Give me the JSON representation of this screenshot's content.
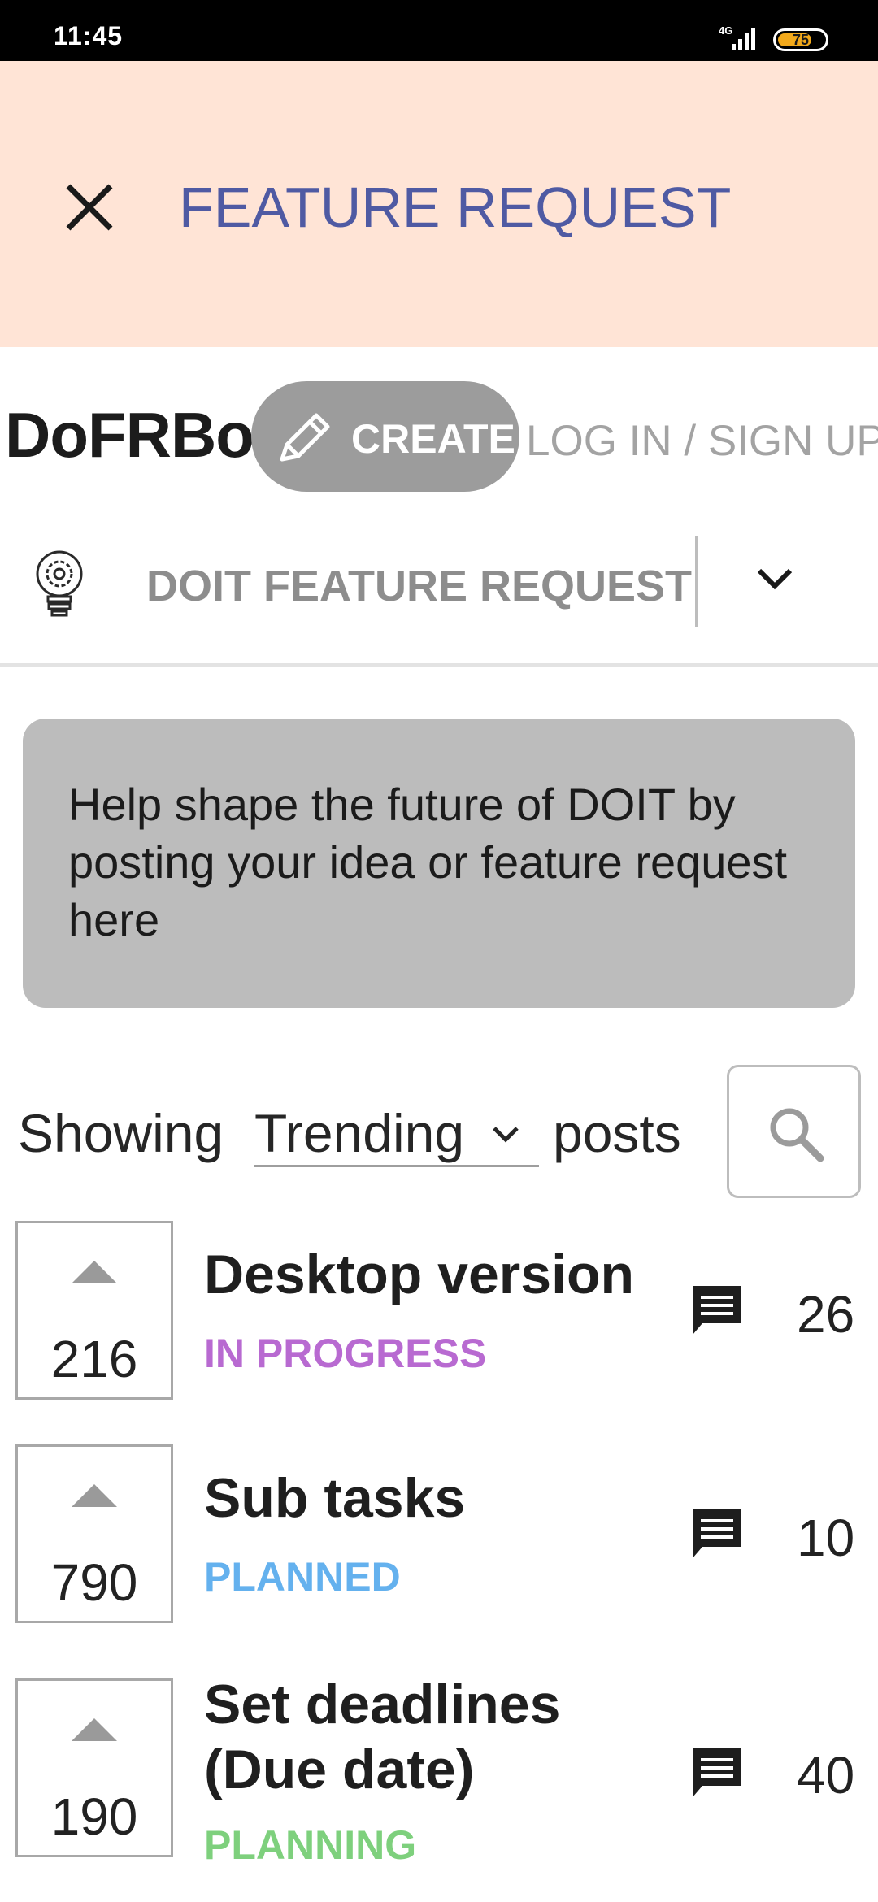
{
  "status_bar": {
    "time": "11:45",
    "network": "4G",
    "battery": "75",
    "battery_level": 0.75
  },
  "header": {
    "title": "FEATURE REQUEST",
    "close_icon": "close-icon"
  },
  "topbar": {
    "brand": "DoFRBo",
    "create_label": "CREATE",
    "login_label": "LOG IN / SIGN UP"
  },
  "board": {
    "name": "DOIT FEATURE REQUEST",
    "icon": "lightbulb-gear-icon"
  },
  "intro": {
    "text": "Help shape the future of DOIT by posting your idea or feature request here"
  },
  "filter": {
    "prefix": "Showing",
    "sort_value": "Trending",
    "suffix": "posts"
  },
  "posts": [
    {
      "votes": "216",
      "title": "Desktop version",
      "status": "IN PROGRESS",
      "status_color": "#b86ad1",
      "comments": "26"
    },
    {
      "votes": "790",
      "title": "Sub tasks",
      "status": "PLANNED",
      "status_color": "#64b1ee",
      "comments": "10"
    },
    {
      "votes": "190",
      "title": "Set deadlines (Due date)",
      "status": "PLANNING",
      "status_color": "#7ed07d",
      "comments": "40"
    }
  ],
  "colors": {
    "header_bg": "#ffe4d6",
    "header_title": "#4f5aa3",
    "create_bg": "#9c9c9c",
    "intro_bg": "#bcbcbc"
  }
}
